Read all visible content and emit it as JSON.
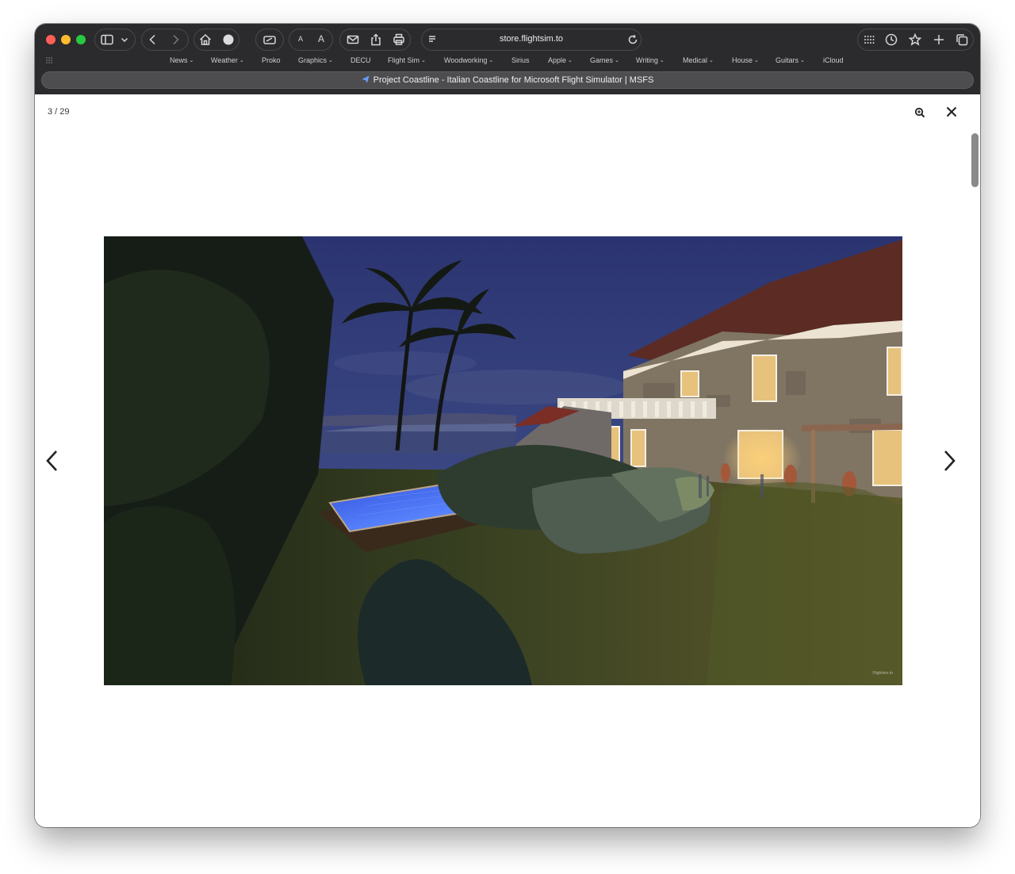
{
  "browser": {
    "url": "store.flightsim.to",
    "bookmarks": [
      "News",
      "Weather",
      "Proko",
      "Graphics",
      "DECU",
      "Flight Sim",
      "Woodworking",
      "Sirius",
      "Apple",
      "Games",
      "Writing",
      "Medical",
      "House",
      "Guitars",
      "iCloud"
    ],
    "bookmarks_with_chevron": [
      "News",
      "Weather",
      "Graphics",
      "Flight Sim",
      "Woodworking",
      "Apple",
      "Games",
      "Writing",
      "Medical",
      "House",
      "Guitars"
    ],
    "tab_title": "Project Coastline - Italian Coastline for Microsoft Flight Simulator | MSFS",
    "font_small": "A",
    "font_large": "A"
  },
  "lightbox": {
    "counter": "3 / 29",
    "watermark": "Flightsim.to"
  },
  "icons": {
    "sidebar": "sidebar-icon",
    "back": "chevron-left-icon",
    "forward": "chevron-right-icon",
    "home": "home-icon",
    "zoom": "zoom-in-icon",
    "close": "close-icon",
    "prev": "arrow-left-icon",
    "next": "arrow-right-icon"
  },
  "colors": {
    "chrome": "#2b2b2d",
    "traffic_red": "#fe5f57",
    "traffic_yellow": "#febc2e",
    "traffic_green": "#28c840",
    "pool": "#3a6bff"
  }
}
